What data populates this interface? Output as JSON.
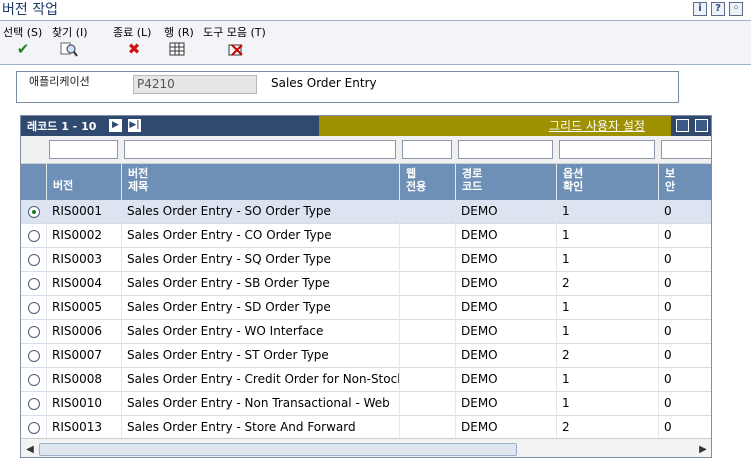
{
  "window": {
    "title": "버전 작업",
    "header_icons": [
      "info-icon",
      "help-icon",
      "bookmark-icon"
    ],
    "header_icon_glyphs": [
      "i",
      "?",
      "◦"
    ]
  },
  "toolbar": {
    "items": [
      {
        "label": "선택 (S)",
        "icon": "checkmark-icon"
      },
      {
        "label": "찾기 (I)",
        "icon": "find-icon"
      },
      {
        "label": "종료 (L)",
        "icon": "close-x-icon"
      },
      {
        "label": "행 (R)",
        "icon": "row-grid-icon"
      },
      {
        "label": "도구 모음 (T)",
        "icon": "tools-icon"
      }
    ]
  },
  "application": {
    "label": "애플리케이션",
    "value": "P4210",
    "description": "Sales Order Entry"
  },
  "grid": {
    "record_text": "레코드 1 - 10",
    "next_icon": "▶",
    "last_icon": "▶|",
    "settings_link": "그리드 사용자 설정",
    "columns": [
      "버전",
      "버전\n제목",
      "웹\n전용",
      "경로\n코드",
      "옵션\n확인",
      "보\n안"
    ],
    "rows": [
      {
        "version": "RIS0001",
        "title": "Sales Order Entry - SO Order Type",
        "web": "",
        "route": "DEMO",
        "option": "1",
        "security": "0",
        "selected": true
      },
      {
        "version": "RIS0002",
        "title": "Sales Order Entry - CO Order Type",
        "web": "",
        "route": "DEMO",
        "option": "1",
        "security": "0",
        "selected": false
      },
      {
        "version": "RIS0003",
        "title": "Sales Order Entry - SQ Order Type",
        "web": "",
        "route": "DEMO",
        "option": "1",
        "security": "0",
        "selected": false
      },
      {
        "version": "RIS0004",
        "title": "Sales Order Entry - SB Order Type",
        "web": "",
        "route": "DEMO",
        "option": "2",
        "security": "0",
        "selected": false
      },
      {
        "version": "RIS0005",
        "title": "Sales Order Entry - SD Order Type",
        "web": "",
        "route": "DEMO",
        "option": "1",
        "security": "0",
        "selected": false
      },
      {
        "version": "RIS0006",
        "title": "Sales Order Entry - WO Interface",
        "web": "",
        "route": "DEMO",
        "option": "1",
        "security": "0",
        "selected": false
      },
      {
        "version": "RIS0007",
        "title": "Sales Order Entry - ST Order Type",
        "web": "",
        "route": "DEMO",
        "option": "2",
        "security": "0",
        "selected": false
      },
      {
        "version": "RIS0008",
        "title": "Sales Order Entry - Credit Order for Non-Stock",
        "web": "",
        "route": "DEMO",
        "option": "1",
        "security": "0",
        "selected": false
      },
      {
        "version": "RIS0010",
        "title": "Sales Order Entry - Non Transactional - Web",
        "web": "",
        "route": "DEMO",
        "option": "1",
        "security": "0",
        "selected": false
      },
      {
        "version": "RIS0013",
        "title": "Sales Order Entry - Store And Forward",
        "web": "",
        "route": "DEMO",
        "option": "2",
        "security": "0",
        "selected": false
      }
    ]
  }
}
